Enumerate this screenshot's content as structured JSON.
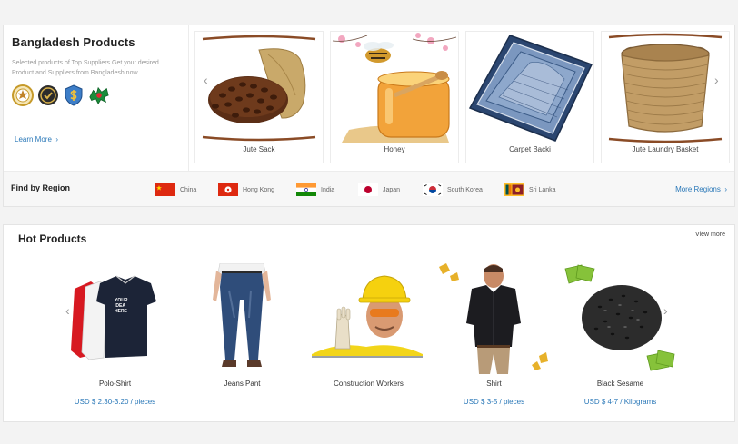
{
  "bangladesh": {
    "title": "Bangladesh Products",
    "description": "Selected products of Top Suppliers Get your desired Product and Suppliers from Bangladesh now.",
    "learn_more": "Learn More",
    "learn_more_arrow": "›",
    "products": [
      {
        "caption": "Jute Sack"
      },
      {
        "caption": "Honey"
      },
      {
        "caption": "Carpet Backi"
      },
      {
        "caption": "Jute Laundry Basket"
      }
    ]
  },
  "regions": {
    "title": "Find by Region",
    "items": [
      {
        "name": "China"
      },
      {
        "name": "Hong Kong"
      },
      {
        "name": "India"
      },
      {
        "name": "Japan"
      },
      {
        "name": "South Korea"
      },
      {
        "name": "Sri Lanka"
      }
    ],
    "more": "More Regions",
    "more_arrow": "›"
  },
  "hot": {
    "title": "Hot Products",
    "view_more": "View more",
    "products": [
      {
        "name": "Polo-Shirt",
        "price": "USD $ 2.30-3.20 / pieces"
      },
      {
        "name": "Jeans Pant",
        "price": ""
      },
      {
        "name": "Construction Workers",
        "price": ""
      },
      {
        "name": "Shirt",
        "price": "USD $ 3-5 / pieces"
      },
      {
        "name": "Black Sesame",
        "price": "USD $ 4-7 / Kilograms"
      }
    ]
  },
  "icons": {
    "carousel_prev": "chevron-left-icon",
    "carousel_next": "chevron-right-icon"
  },
  "colors": {
    "link": "#2a78b8",
    "heading": "#222222"
  }
}
